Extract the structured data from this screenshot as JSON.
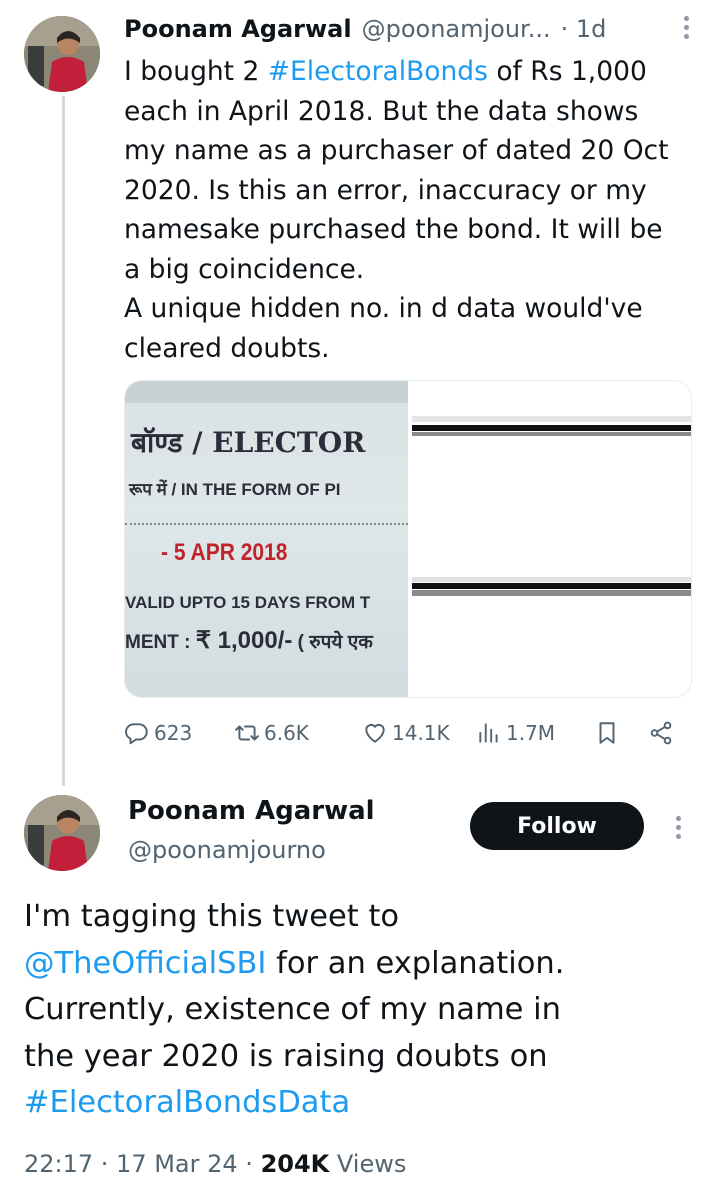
{
  "tweet1": {
    "author_name": "Poonam Agarwal",
    "author_handle": "@poonamjour...",
    "time": "· 1d",
    "text_lines": [
      {
        "pre": "I bought 2 ",
        "tag": "#ElectoralBonds",
        "post": " of Rs 1,000"
      },
      {
        "pre": "each in April 2018. But the data shows",
        "tag": "",
        "post": ""
      },
      {
        "pre": "my name as a purchaser of dated 20 Oct",
        "tag": "",
        "post": ""
      },
      {
        "pre": "2020. Is this an error, inaccuracy or my",
        "tag": "",
        "post": ""
      },
      {
        "pre": "namesake purchased the bond. It will be",
        "tag": "",
        "post": ""
      },
      {
        "pre": "a big coincidence.",
        "tag": "",
        "post": ""
      },
      {
        "pre": "A unique hidden no. in d data would've",
        "tag": "",
        "post": ""
      },
      {
        "pre": "cleared doubts.",
        "tag": "",
        "post": ""
      }
    ],
    "media": {
      "bond_title": "बॉण्ड / ELECTOR",
      "bond_form": "रूप में / IN THE FORM OF PI",
      "bond_date": "- 5 APR 2018",
      "bond_valid": "VALID UPTO 15 DAYS FROM T",
      "bond_amount_label": "MENT : ",
      "bond_amount": "₹ 1,000/-",
      "bond_amount_words": " ( रुपये एक"
    },
    "actions": {
      "replies": "623",
      "retweets": "6.6K",
      "likes": "14.1K",
      "views": "1.7M"
    }
  },
  "tweet2": {
    "author_name": "Poonam Agarwal",
    "author_handle": "@poonamjourno",
    "follow_label": "Follow",
    "text_lines": [
      {
        "pre": "I'm tagging this tweet to",
        "link": "",
        "post": ""
      },
      {
        "pre": "",
        "link": "@TheOfficialSBI",
        "post": " for an explanation."
      },
      {
        "pre": "Currently, existence of my name in",
        "link": "",
        "post": ""
      },
      {
        "pre": "the year 2020 is raising doubts on",
        "link": "",
        "post": ""
      },
      {
        "pre": "",
        "link": "#ElectoralBondsData",
        "post": ""
      }
    ],
    "meta_time": "22:17 · 17 Mar 24 · ",
    "meta_views_count": "204K",
    "meta_views_label": " Views"
  },
  "icons": [
    "reply-icon",
    "retweet-icon",
    "like-icon",
    "views-icon",
    "bookmark-icon",
    "share-icon",
    "more-icon"
  ],
  "colors": {
    "link": "#1d9bf0",
    "text": "#0f1419",
    "muted": "#536471",
    "follow_bg": "#0f1419"
  }
}
